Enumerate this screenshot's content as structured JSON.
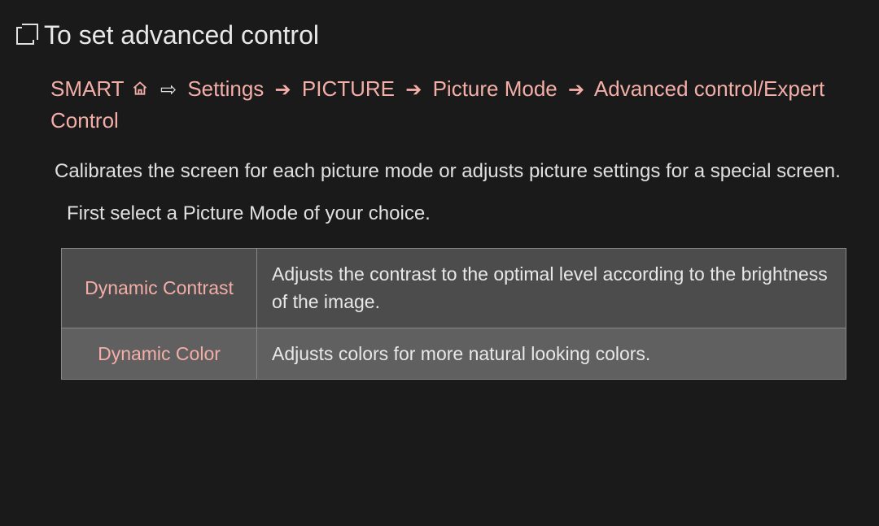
{
  "title": "To set advanced control",
  "breadcrumb": {
    "smart": "SMART",
    "items": [
      "Settings",
      "PICTURE",
      "Picture Mode",
      "Advanced control/Expert Control"
    ]
  },
  "paragraphs": {
    "p1": "Calibrates the screen for each picture mode or adjusts picture settings for a special screen.",
    "p2": "First select a Picture Mode of your choice."
  },
  "table": [
    {
      "label": "Dynamic Contrast",
      "desc": "Adjusts the contrast to the optimal level according to the brightness of the image."
    },
    {
      "label": "Dynamic Color",
      "desc": "Adjusts colors for more natural looking colors."
    }
  ]
}
